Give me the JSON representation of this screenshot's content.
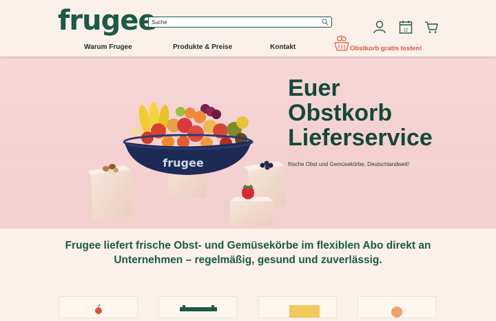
{
  "brand": {
    "logo_text": "frugee",
    "primary_color": "#1b5a47",
    "accent_color": "#e0533b"
  },
  "search": {
    "placeholder": "Suche"
  },
  "header_icons": [
    "user-icon",
    "calendar-icon",
    "cart-icon"
  ],
  "calendar_icon_text": "12",
  "nav": {
    "items": [
      "Warum Frugee",
      "Produkte & Preise",
      "Kontakt"
    ]
  },
  "cta": {
    "label": "Obstkorb gratis testen!"
  },
  "hero": {
    "title_lines": [
      "Euer",
      "Obstkorb",
      "Lieferservice"
    ],
    "subtitle": "frische Obst und Gemüsekörbe, Deutschlandweit!",
    "bowl_text": "frugee"
  },
  "tagline": "Frugee liefert frische Obst- und Gemüsekörbe im flexiblen Abo direkt an Unternehmen – regelmäßig, gesund und zuverlässig."
}
